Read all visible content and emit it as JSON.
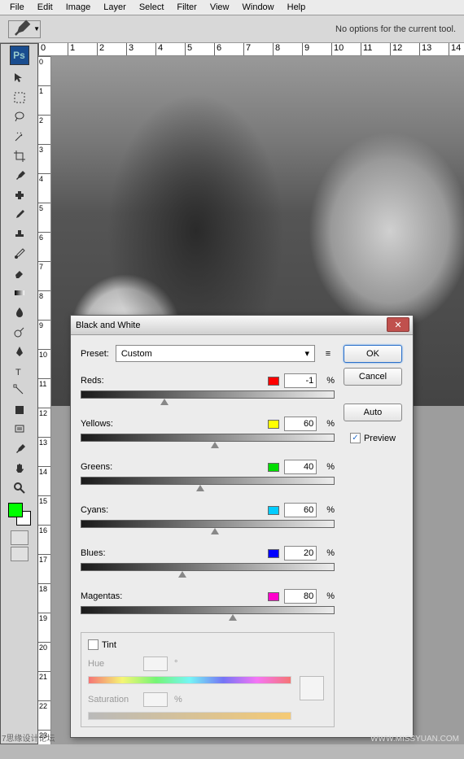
{
  "menu": [
    "File",
    "Edit",
    "Image",
    "Layer",
    "Select",
    "Filter",
    "View",
    "Window",
    "Help"
  ],
  "options_bar": {
    "text": "No options for the current tool."
  },
  "ruler_ticks_h": [
    "0",
    "1",
    "2",
    "3",
    "4",
    "5",
    "6",
    "7",
    "8",
    "9",
    "10",
    "11",
    "12",
    "13",
    "14"
  ],
  "ruler_ticks_v": [
    "0",
    "1",
    "2",
    "3",
    "4",
    "5",
    "6",
    "7",
    "8",
    "9",
    "10",
    "11",
    "12",
    "13",
    "14",
    "15",
    "16",
    "17",
    "18",
    "19",
    "20",
    "21",
    "22",
    "23"
  ],
  "dialog": {
    "title": "Black and White",
    "preset_label": "Preset:",
    "preset_value": "Custom",
    "sliders": [
      {
        "label": "Reds:",
        "color": "#ff0000",
        "value": "-1",
        "pos": 33
      },
      {
        "label": "Yellows:",
        "color": "#ffff00",
        "value": "60",
        "pos": 53
      },
      {
        "label": "Greens:",
        "color": "#00dd00",
        "value": "40",
        "pos": 47
      },
      {
        "label": "Cyans:",
        "color": "#00ccff",
        "value": "60",
        "pos": 53
      },
      {
        "label": "Blues:",
        "color": "#0000ff",
        "value": "20",
        "pos": 40
      },
      {
        "label": "Magentas:",
        "color": "#ff00cc",
        "value": "80",
        "pos": 60
      }
    ],
    "percent": "%",
    "tint_label": "Tint",
    "hue_label": "Hue",
    "sat_label": "Saturation",
    "deg": "°",
    "ok": "OK",
    "cancel": "Cancel",
    "auto": "Auto",
    "preview": "Preview"
  },
  "watermark": "WWW.MISSYUAN.COM",
  "footer": "7思缘设计论坛",
  "ps_logo": "Ps"
}
